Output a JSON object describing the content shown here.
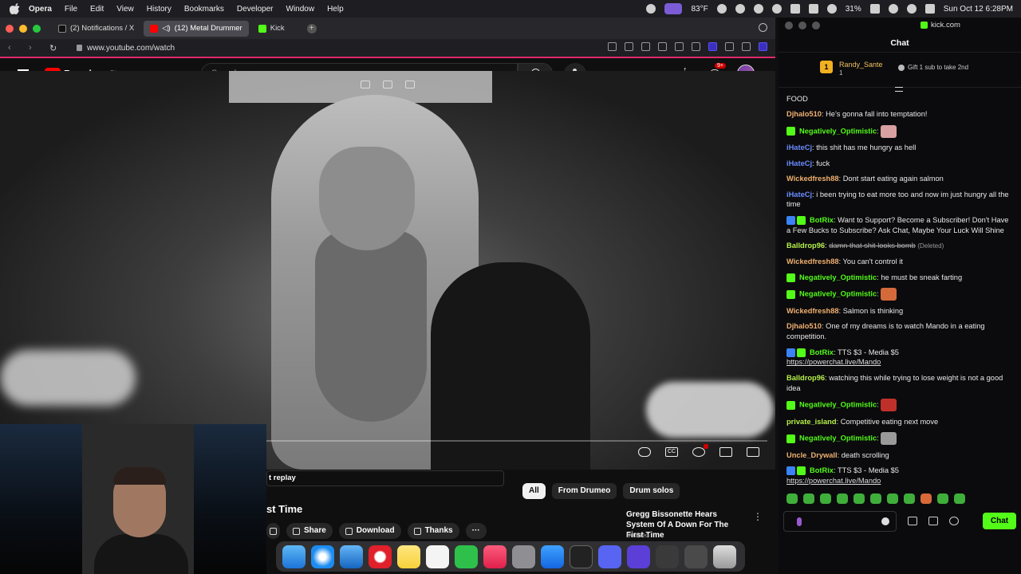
{
  "menubar": {
    "app_name": "Opera",
    "items": [
      "File",
      "Edit",
      "View",
      "History",
      "Bookmarks",
      "Developer",
      "Window",
      "Help"
    ],
    "temperature": "83°F",
    "battery": "31%",
    "datetime": "Sun Oct 12  6:28PM"
  },
  "browser": {
    "tabs": [
      {
        "label": "(2) Notifications / X",
        "favicon_color": "#111111"
      },
      {
        "label": "(12) Metal Drummer",
        "favicon_color": "#ff0000"
      },
      {
        "label": "Kick",
        "favicon_color": "#53fc18"
      }
    ],
    "url": "www.youtube.com/watch"
  },
  "youtube": {
    "logo_text": "Premium",
    "logo_sup": "TH",
    "search_placeholder": "Search",
    "notification_badge": "9+",
    "replay_text": "t replay",
    "video_title_fragment": "st Time",
    "actions": {
      "share": "Share",
      "download": "Download",
      "thanks": "Thanks",
      "more": "···"
    },
    "chips": [
      {
        "label": "All",
        "selected": true
      },
      {
        "label": "From Drumeo",
        "selected": false
      },
      {
        "label": "Drum solos",
        "selected": false
      }
    ],
    "recommended": {
      "title": "Gregg Bissonette Hears System Of A Down For The First Time",
      "channel": "Drumeo"
    }
  },
  "kick": {
    "window_title": "kick.com",
    "chat_header": "Chat",
    "pinned": {
      "user": "Randy_Sante",
      "count": "1",
      "rank": "1",
      "gift_text": "Gift 1 sub to take 2nd"
    },
    "messages": [
      {
        "user": "",
        "color": "#e8e8e8",
        "text": "FOOD",
        "badges": [],
        "emote": ""
      },
      {
        "user": "Djhalo510",
        "color": "#f0b070",
        "text": "He's gonna fall into temptation!",
        "badges": [],
        "emote": ""
      },
      {
        "user": "Negatively_Optimistic",
        "color": "#53fc18",
        "text": "",
        "badges": [
          "#53fc18"
        ],
        "emote": "#d8a0a0"
      },
      {
        "user": "iHateCj",
        "color": "#6a8cff",
        "text": "this shit has me hungry as hell",
        "badges": [],
        "emote": ""
      },
      {
        "user": "iHateCj",
        "color": "#6a8cff",
        "text": "fuck",
        "badges": [],
        "emote": ""
      },
      {
        "user": "Wickedfresh88",
        "color": "#f0b070",
        "text": "Dont start eating again salmon",
        "badges": [],
        "emote": ""
      },
      {
        "user": "iHateCj",
        "color": "#6a8cff",
        "text": "i been trying to eat more too and now im just hungry all the time",
        "badges": [],
        "emote": ""
      },
      {
        "user": "BotRix",
        "color": "#53fc18",
        "text": "Want to Support? Become a Subscriber! Don't Have a Few Bucks to Subscribe? Ask Chat, Maybe Your Luck Will Shine",
        "badges": [
          "#3b82f6",
          "#53fc18"
        ],
        "emote": ""
      },
      {
        "user": "Balldrop96",
        "color": "#b6f04a",
        "text": "damn that shit looks bomb",
        "deleted": "(Deleted)",
        "badges": [],
        "emote": ""
      },
      {
        "user": "Wickedfresh88",
        "color": "#f0b070",
        "text": "You can't control it",
        "badges": [],
        "emote": ""
      },
      {
        "user": "Negatively_Optimistic",
        "color": "#53fc18",
        "text": "he must be sneak farting",
        "badges": [
          "#53fc18"
        ],
        "emote": ""
      },
      {
        "user": "Negatively_Optimistic",
        "color": "#53fc18",
        "text": "",
        "badges": [
          "#53fc18"
        ],
        "emote": "#d46a3a"
      },
      {
        "user": "Wickedfresh88",
        "color": "#f0b070",
        "text": "Salmon is thinking",
        "badges": [],
        "emote": ""
      },
      {
        "user": "Djhalo510",
        "color": "#f0b070",
        "text": "One of my dreams is to watch Mando in a eating competition.",
        "badges": [],
        "emote": ""
      },
      {
        "user": "BotRix",
        "color": "#53fc18",
        "text": "TTS $3 - Media $5",
        "link": "https://powerchat.live/Mando",
        "badges": [
          "#3b82f6",
          "#53fc18"
        ],
        "emote": ""
      },
      {
        "user": "Balldrop96",
        "color": "#b6f04a",
        "text": "watching this while trying to lose weight is not a good idea",
        "badges": [],
        "emote": ""
      },
      {
        "user": "Negatively_Optimistic",
        "color": "#53fc18",
        "text": "",
        "badges": [
          "#53fc18"
        ],
        "emote": "#c0302a"
      },
      {
        "user": "private_island",
        "color": "#b6f04a",
        "text": "Competitive eating next move",
        "badges": [],
        "emote": ""
      },
      {
        "user": "Negatively_Optimistic",
        "color": "#53fc18",
        "text": "",
        "badges": [
          "#53fc18"
        ],
        "emote": "#9a9a9a"
      },
      {
        "user": "Uncle_Drywall",
        "color": "#f0b070",
        "text": "death scrolling",
        "badges": [],
        "emote": ""
      },
      {
        "user": "BotRix",
        "color": "#53fc18",
        "text": "TTS $3 - Media $5",
        "link": "https://powerchat.live/Mando",
        "badges": [
          "#3b82f6",
          "#53fc18"
        ],
        "emote": ""
      }
    ],
    "send_button": "Chat"
  },
  "colors": {
    "kick_green": "#53fc18",
    "youtube_red": "#ff0000",
    "opera_accent": "#e0286a"
  }
}
